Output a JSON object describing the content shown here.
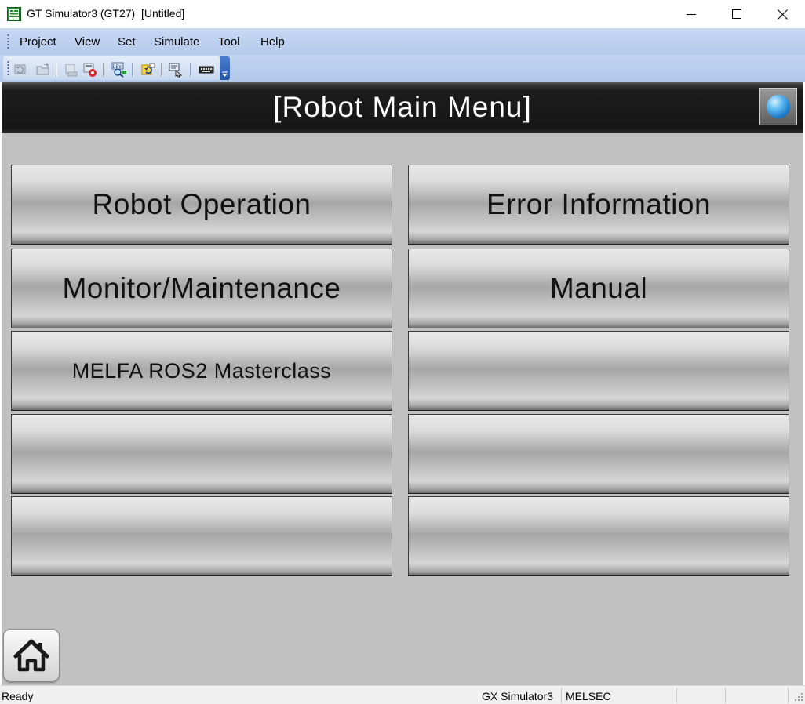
{
  "window": {
    "title": "GT Simulator3 (GT27)  [Untitled]",
    "controls": {
      "minimize_icon": "minimize-icon",
      "maximize_icon": "maximize-icon",
      "close_icon": "close-icon"
    }
  },
  "menubar": {
    "items": [
      "Project",
      "View",
      "Set",
      "Simulate",
      "Tool",
      "Help"
    ]
  },
  "toolbar": {
    "buttons": [
      "start-simulation-icon",
      "open-project-icon",
      "print-icon",
      "device-monitor-icon",
      "search-icon",
      "script-icon",
      "touch-input-icon",
      "keyboard-icon"
    ],
    "overflow_icon": "toolbar-overflow-icon"
  },
  "screen": {
    "title": "[Robot Main Menu]",
    "globe_icon": "globe-icon",
    "buttons": [
      {
        "label": "Robot Operation"
      },
      {
        "label": "Error Information"
      },
      {
        "label": "Monitor/Maintenance"
      },
      {
        "label": "Manual"
      },
      {
        "label": "MELFA ROS2 Masterclass"
      },
      {
        "label": ""
      },
      {
        "label": ""
      },
      {
        "label": ""
      },
      {
        "label": ""
      },
      {
        "label": ""
      }
    ],
    "home_icon": "home-icon"
  },
  "statusbar": {
    "status": "Ready",
    "simulator": "GX Simulator3",
    "connection": "MELSEC"
  },
  "colors": {
    "menubar_bg": "#b8cdee",
    "screen_bg": "#c0c0c0",
    "header_bg": "#161616",
    "button_face": "#c8c8c8"
  }
}
